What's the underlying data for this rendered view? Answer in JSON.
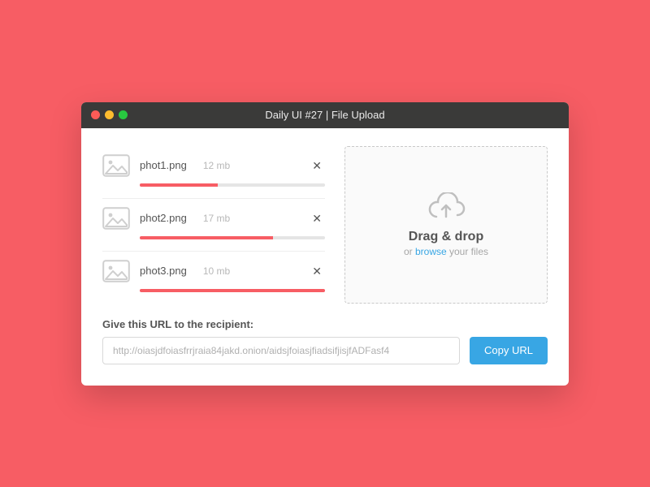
{
  "window": {
    "title": "Daily UI #27 | File Upload"
  },
  "files": [
    {
      "name": "phot1.png",
      "size": "12 mb",
      "progress": 42
    },
    {
      "name": "phot2.png",
      "size": "17 mb",
      "progress": 72
    },
    {
      "name": "phot3.png",
      "size": "10 mb",
      "progress": 100
    }
  ],
  "dropzone": {
    "title": "Drag & drop",
    "sub_prefix": "or ",
    "browse": "browse",
    "sub_suffix": " your files"
  },
  "url": {
    "label": "Give this URL to the recipient:",
    "value": "http://oiasjdfoiasfrrjraia84jakd.onion/aidsjfoiasjfiadsifjisjfADFasf4",
    "copy": "Copy URL"
  }
}
